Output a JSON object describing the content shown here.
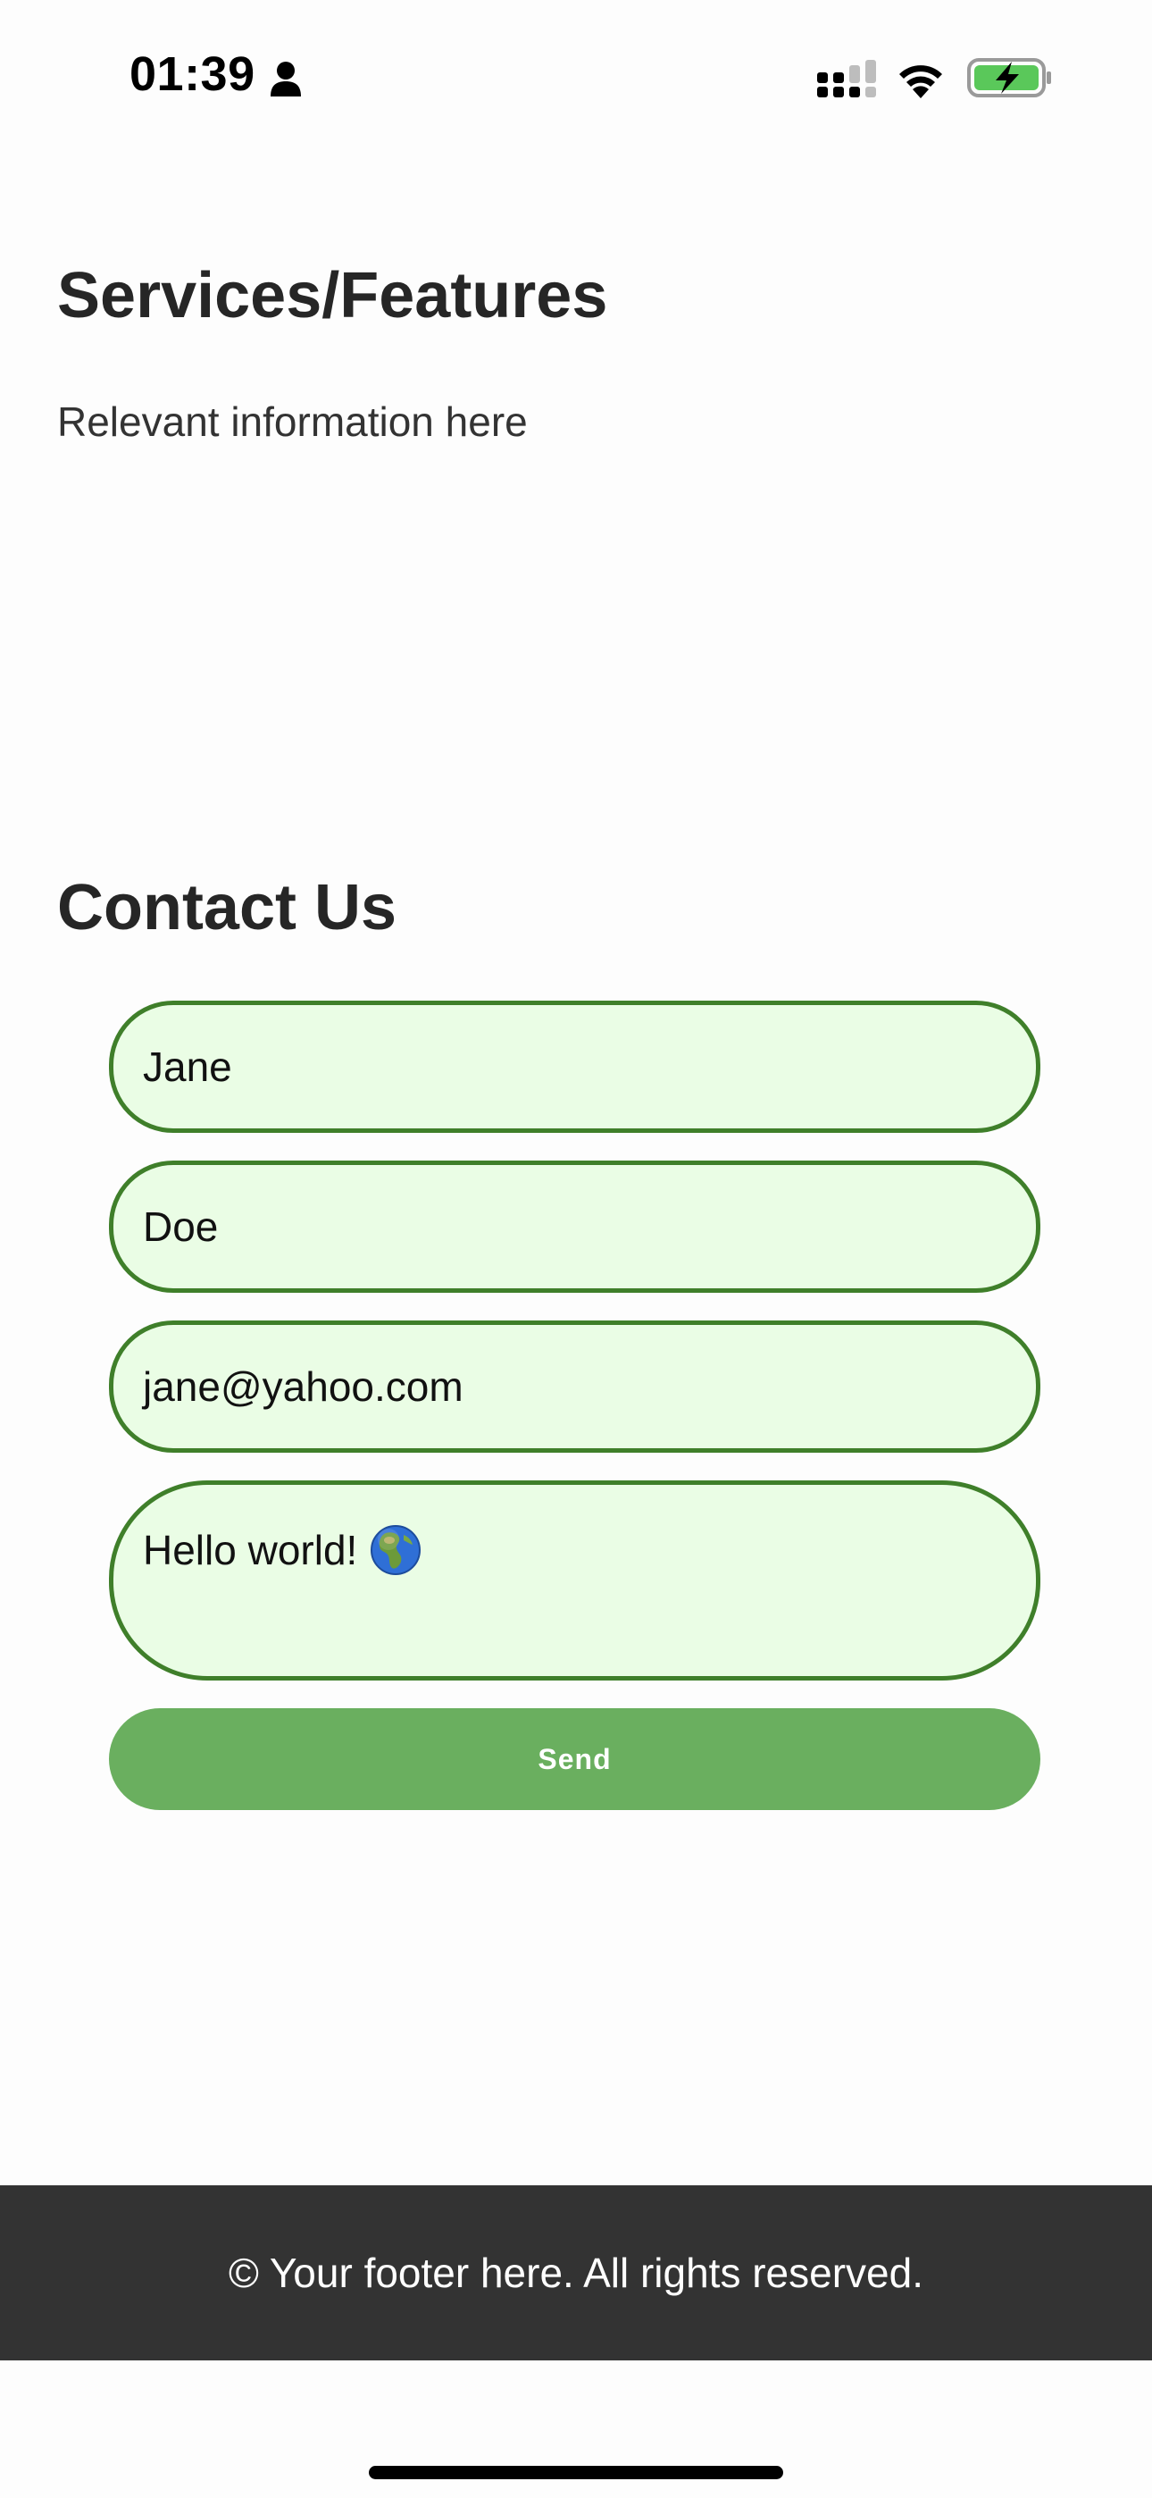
{
  "status_bar": {
    "time": "01:39",
    "icons": [
      "person-icon",
      "cellular-signal-icon",
      "wifi-icon",
      "battery-charging-icon"
    ]
  },
  "services": {
    "title": "Services/Features",
    "text": "Relevant information here"
  },
  "contact": {
    "title": "Contact Us",
    "first_name": "Jane",
    "last_name": "Doe",
    "email": "jane@yahoo.com",
    "message": "Hello world!",
    "message_icon": "globe-icon",
    "send_label": "Send"
  },
  "footer": {
    "text": "© Your footer here. All rights reserved."
  },
  "colors": {
    "field_background": "#eafde5",
    "field_border": "#3f7f2a",
    "button": "#6aaf5f",
    "footer_background": "#333333"
  }
}
